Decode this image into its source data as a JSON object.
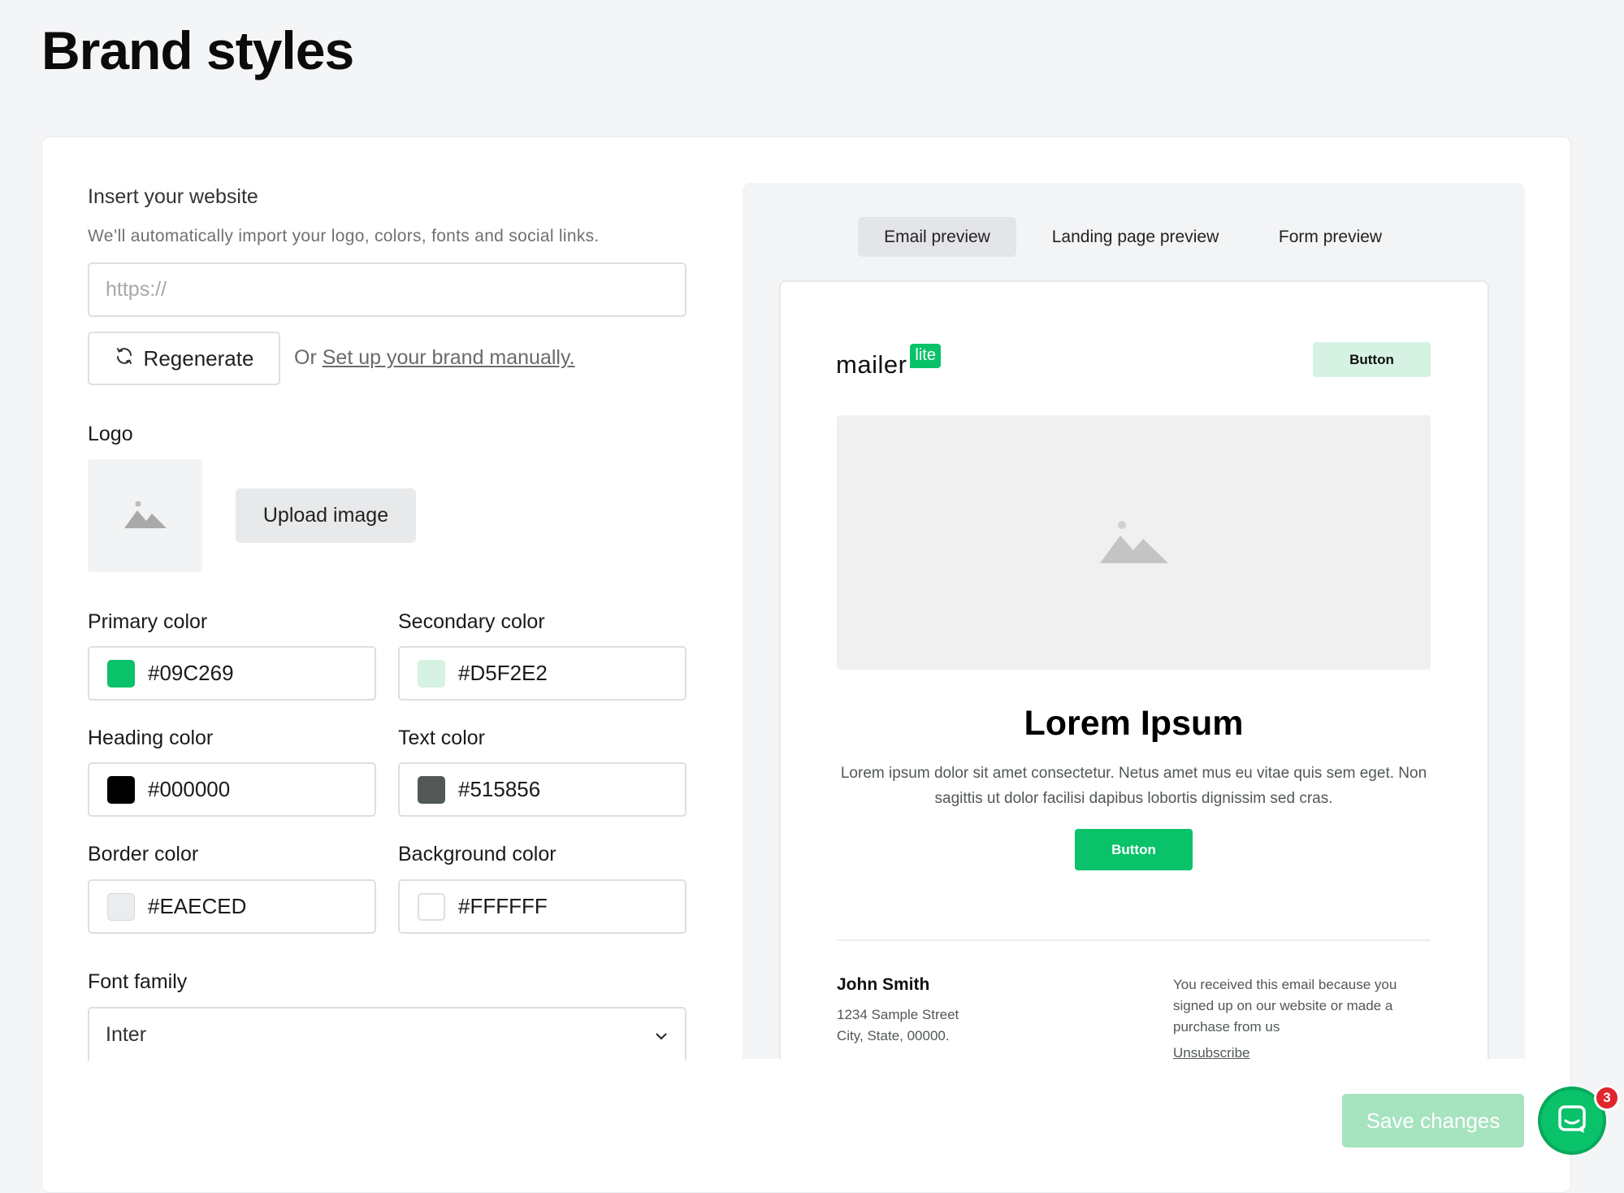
{
  "page": {
    "title": "Brand styles"
  },
  "website": {
    "label": "Insert your website",
    "help": "We’ll automatically import your logo, colors, fonts and social links.",
    "placeholder": "https://",
    "regenerate_label": "Regenerate",
    "or_text": "Or",
    "manual_link": "Set up your brand manually."
  },
  "logo": {
    "label": "Logo",
    "upload_label": "Upload image"
  },
  "colors": {
    "primary": {
      "label": "Primary color",
      "value": "#09C269"
    },
    "secondary": {
      "label": "Secondary color",
      "value": "#D5F2E2"
    },
    "heading": {
      "label": "Heading color",
      "value": "#000000"
    },
    "text": {
      "label": "Text color",
      "value": "#515856"
    },
    "border": {
      "label": "Border color",
      "value": "#EAECED"
    },
    "background": {
      "label": "Background color",
      "value": "#FFFFFF"
    }
  },
  "font": {
    "label": "Font family",
    "value": "Inter"
  },
  "preview": {
    "tabs": [
      {
        "label": "Email preview",
        "active": true
      },
      {
        "label": "Landing page preview",
        "active": false
      },
      {
        "label": "Form preview",
        "active": false
      }
    ],
    "email": {
      "logo_word": "mailer",
      "logo_badge": "lite",
      "header_button": "Button",
      "title": "Lorem Ipsum",
      "body": "Lorem ipsum dolor sit amet consectetur. Netus amet mus eu vitae quis sem eget. Non sagittis ut dolor facilisi dapibus lobortis dignissim sed cras.",
      "cta_button": "Button",
      "footer": {
        "name": "John Smith",
        "address_line1": "1234 Sample Street",
        "address_line2": "City, State, 00000.",
        "note": "You received this email because you signed up on our website or made a purchase from us",
        "unsubscribe": "Unsubscribe"
      }
    }
  },
  "actions": {
    "save_label": "Save changes"
  },
  "chat": {
    "badge_count": "3",
    "icon": "chat-bubble-icon"
  }
}
